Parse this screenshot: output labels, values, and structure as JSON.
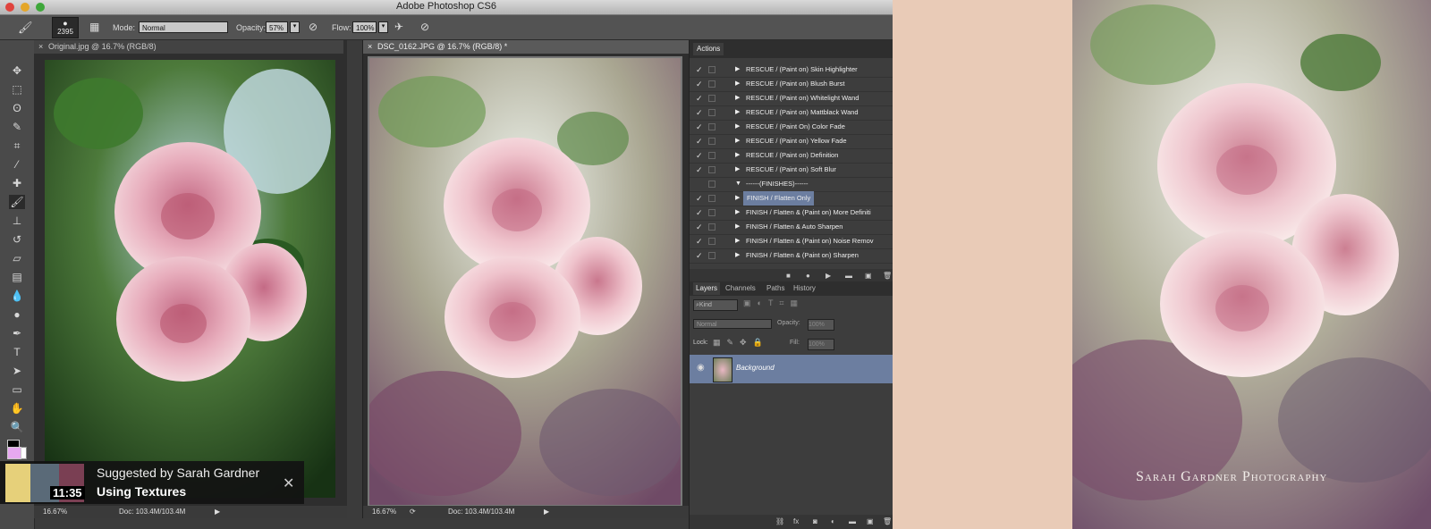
{
  "window": {
    "title": "Adobe Photoshop CS6"
  },
  "options_bar": {
    "brush_size": "2395",
    "mode_label": "Mode:",
    "mode_value": "Normal",
    "opacity_label": "Opacity:",
    "opacity_value": "57%",
    "flow_label": "Flow:",
    "flow_value": "100%"
  },
  "documents": [
    {
      "tab": "Original.jpg @ 16.7% (RGB/8)",
      "zoom": "16.67%",
      "doc_size": "Doc: 103.4M/103.4M"
    },
    {
      "tab": "DSC_0162.JPG @ 16.7% (RGB/8) *",
      "zoom": "16.67%",
      "doc_size": "Doc: 103.4M/103.4M"
    }
  ],
  "actions_panel": {
    "title": "Actions",
    "items": [
      {
        "label": "RESCUE / (Paint on) Skin Highlighter",
        "checked": true
      },
      {
        "label": "RESCUE / (Paint on) Blush Burst",
        "checked": true
      },
      {
        "label": "RESCUE / (Paint on) Whitelight Wand",
        "checked": true
      },
      {
        "label": "RESCUE / (Paint on) Mattblack Wand",
        "checked": true
      },
      {
        "label": "RESCUE / (Paint On) Color Fade",
        "checked": true
      },
      {
        "label": "RESCUE / (Paint on) Yellow Fade",
        "checked": true
      },
      {
        "label": "RESCUE / (Paint on) Definition",
        "checked": true
      },
      {
        "label": "RESCUE / (Paint on) Soft Blur",
        "checked": true
      },
      {
        "label": "------(FINISHES)------",
        "checked": false
      },
      {
        "label": "FINISH / Flatten Only",
        "checked": true
      },
      {
        "label": "FINISH / Flatten & (Paint on) More Definiti",
        "checked": true
      },
      {
        "label": "FINISH / Flatten & Auto Sharpen",
        "checked": true
      },
      {
        "label": "FINISH / Flatten & (Paint on) Noise Remov",
        "checked": true
      },
      {
        "label": "FINISH / Flatten & (Paint on) Sharpen",
        "checked": true
      }
    ]
  },
  "layers_panel": {
    "tabs": [
      "Layers",
      "Channels",
      "Paths",
      "History"
    ],
    "kind_label": "Kind",
    "blend_mode": "Normal",
    "opacity_label": "Opacity:",
    "opacity_value": "100%",
    "lock_label": "Lock:",
    "fill_label": "Fill:",
    "fill_value": "100%",
    "layer_name": "Background"
  },
  "suggestion": {
    "by": "Suggested by Sarah Gardner",
    "title": "Using Textures",
    "duration": "11:35"
  },
  "watermark": "Sarah Gardner Photography",
  "colors": {
    "accent": "#6c7ea0",
    "background": "#e9cbb7",
    "panel": "#3d3d3d"
  }
}
